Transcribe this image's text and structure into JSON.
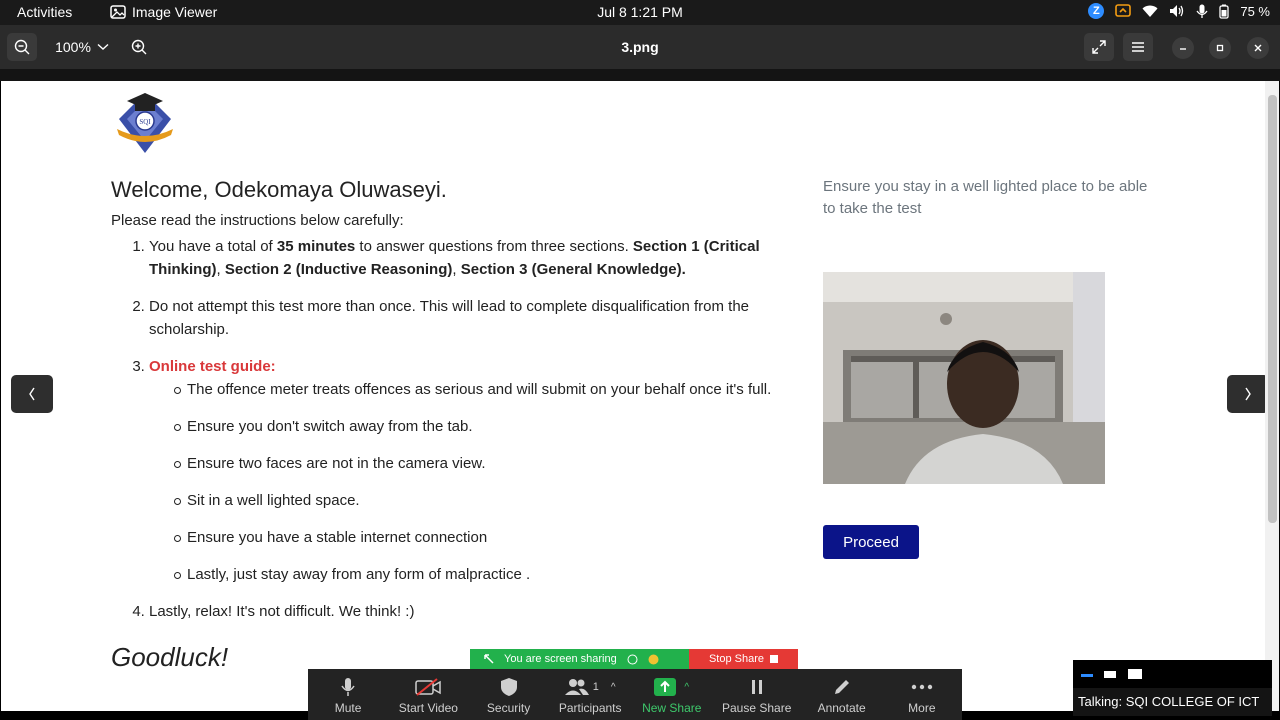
{
  "topbar": {
    "activities": "Activities",
    "app_name": "Image Viewer",
    "clock": "Jul 8   1:21 PM",
    "battery": "75 %"
  },
  "viewer": {
    "zoom": "100%",
    "title": "3.png"
  },
  "page": {
    "welcome": "Welcome, Odekomaya Oluwaseyi.",
    "intro": "Please read the instructions below carefully:",
    "item1": {
      "a": "You have a total of ",
      "b": "35 minutes",
      "c": " to answer questions from three sections. ",
      "d": "Section 1 (Critical Thinking)",
      "e": ", ",
      "f": "Section 2 (Inductive Reasoning)",
      "g": ", ",
      "h": "Section 3 (General Knowledge)."
    },
    "item2": "Do not attempt this test more than once. This will lead to complete disqualification from the scholarship.",
    "item3_title": "Online test guide:",
    "guide": [
      "The offence meter treats offences as serious and will submit on your behalf once it's full.",
      "Ensure you don't switch away from the tab.",
      "Ensure two faces are not in the camera view.",
      "Sit in a well lighted space.",
      "Ensure you have a stable internet connection",
      "Lastly, just stay away from any form of malpractice ."
    ],
    "item4": "Lastly, relax! It's not difficult. We think! :)",
    "goodluck": "Goodluck!",
    "side_note": "Ensure you stay in a well lighted place to be able to take the test",
    "proceed": "Proceed"
  },
  "zoom": {
    "sharing": "You are screen sharing",
    "stop_share": "Stop Share",
    "toolbar": [
      "Mute",
      "Start Video",
      "Security",
      "Participants",
      "New Share",
      "Pause Share",
      "Annotate",
      "More"
    ],
    "participants_count": "1",
    "talking": "Talking: SQI COLLEGE OF ICT"
  }
}
